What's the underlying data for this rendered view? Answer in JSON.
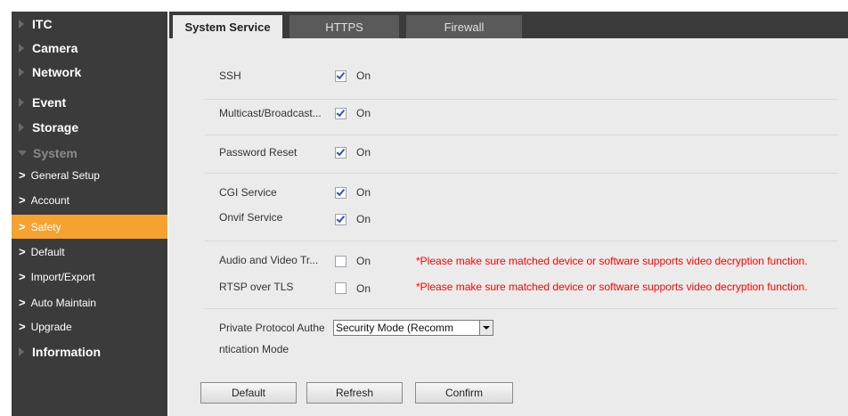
{
  "sidebar": {
    "items": [
      {
        "label": "ITC"
      },
      {
        "label": "Camera"
      },
      {
        "label": "Network"
      },
      {
        "label": "Event"
      },
      {
        "label": "Storage"
      },
      {
        "label": "System"
      },
      {
        "label": "Information"
      }
    ],
    "sub_items": [
      {
        "label": "General Setup"
      },
      {
        "label": "Account"
      },
      {
        "label": "Safety"
      },
      {
        "label": "Default"
      },
      {
        "label": "Import/Export"
      },
      {
        "label": "Auto Maintain"
      },
      {
        "label": "Upgrade"
      }
    ]
  },
  "tabs": [
    {
      "label": "System Service"
    },
    {
      "label": "HTTPS"
    },
    {
      "label": "Firewall"
    }
  ],
  "settings": {
    "ssh": {
      "label": "SSH",
      "checked": true,
      "value": "On"
    },
    "multicast": {
      "label": "Multicast/Broadcast...",
      "checked": true,
      "value": "On"
    },
    "password_reset": {
      "label": "Password Reset",
      "checked": true,
      "value": "On"
    },
    "cgi": {
      "label": "CGI Service",
      "checked": true,
      "value": "On"
    },
    "onvif": {
      "label": "Onvif Service",
      "checked": true,
      "value": "On"
    },
    "av_transmission": {
      "label": "Audio and Video Tr...",
      "checked": false,
      "value": "On"
    },
    "rtsp_tls": {
      "label": "RTSP over TLS",
      "checked": false,
      "value": "On"
    },
    "private_protocol": {
      "label_line1": "Private Protocol Authe",
      "label_line2": "ntication Mode",
      "selected": "Security Mode (Recomm"
    }
  },
  "warning_text": "*Please make sure matched device or software supports video decryption function.",
  "buttons": {
    "default": "Default",
    "refresh": "Refresh",
    "confirm": "Confirm"
  },
  "colors": {
    "sidebar_bg": "#3b3b3b",
    "active_accent": "#f6a230",
    "warning": "#ff0000"
  }
}
